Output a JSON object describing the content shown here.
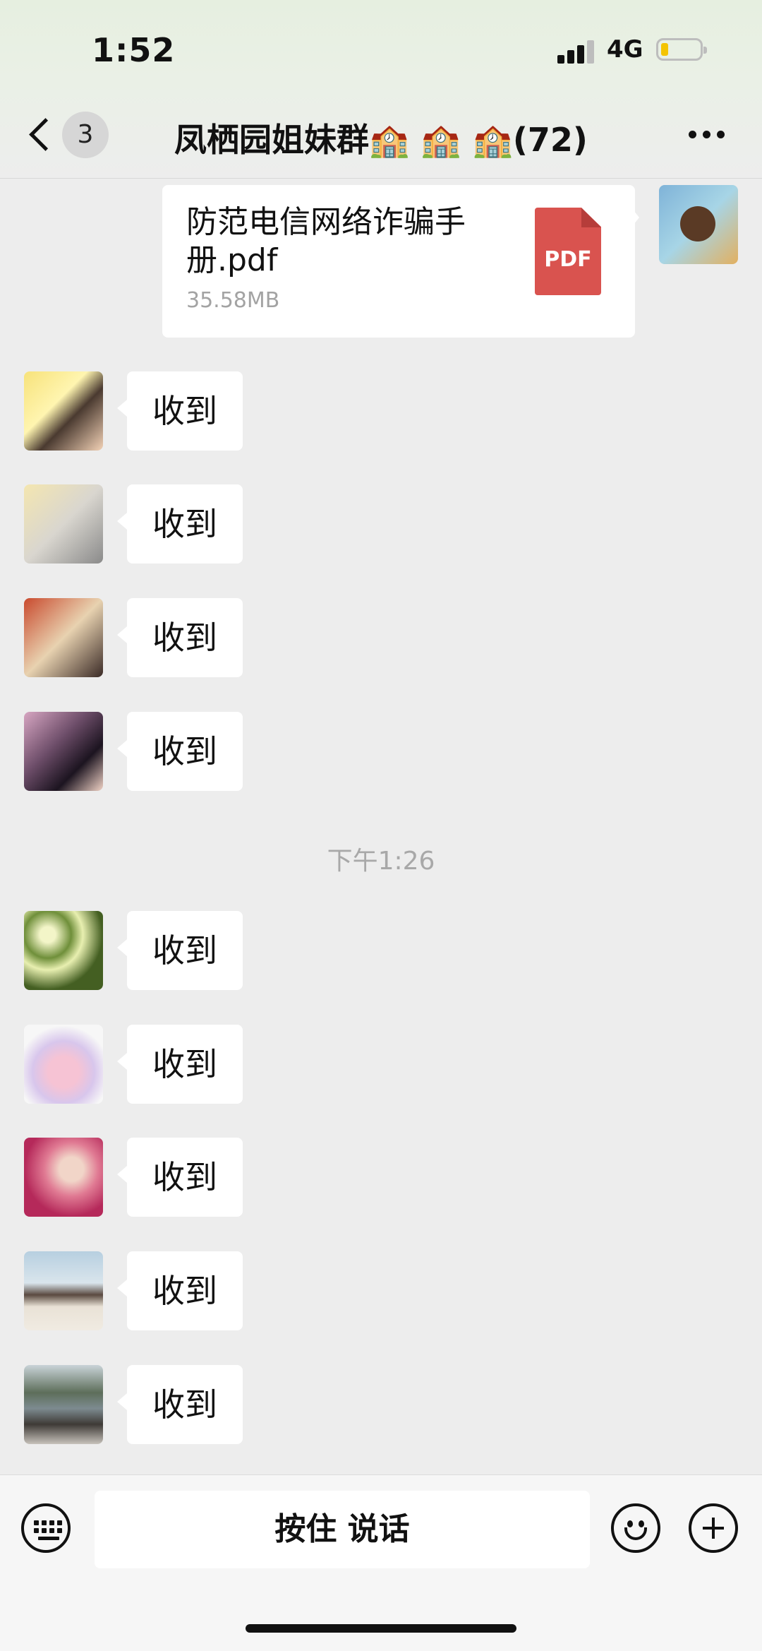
{
  "status_bar": {
    "time": "1:52",
    "network": "4G"
  },
  "header": {
    "back_icon": "chevron-left-icon",
    "unread_count": "3",
    "title": "凤栖园姐妹群🏫 🏫 🏫(72)",
    "more_icon": "ellipsis-icon"
  },
  "file_message": {
    "file_name": "防范电信网络诈骗手册.pdf",
    "file_size": "35.58MB",
    "file_type": "PDF"
  },
  "messages_before": [
    {
      "text": "收到",
      "avatar": "anime-girl-praying",
      "color": "#f7e27a"
    },
    {
      "text": "收到",
      "avatar": "anime-blonde-boy",
      "color": "#d9d6cf"
    },
    {
      "text": "收到",
      "avatar": "cartoon-family",
      "color": "#c94a2e"
    },
    {
      "text": "收到",
      "avatar": "anime-girl-dark-hair",
      "color": "#6e4e6a"
    }
  ],
  "time_separator": "下午1:26",
  "messages_after": [
    {
      "text": "收到",
      "avatar": "white-flowers",
      "color": "#6f8f3a"
    },
    {
      "text": "收到",
      "avatar": "pink-bunny-sticker",
      "color": "#d8c6ec"
    },
    {
      "text": "收到",
      "avatar": "pink-flowers-portrait",
      "color": "#e07a93"
    },
    {
      "text": "收到",
      "avatar": "beach-couple",
      "color": "#b7cfe0"
    },
    {
      "text": "收到",
      "avatar": "lakeside-couple",
      "color": "#5d6e5a"
    }
  ],
  "input_bar": {
    "voice_button_label": "按住 说话",
    "left_icon": "keyboard-icon",
    "emoji_icon": "emoji-icon",
    "plus_icon": "plus-icon"
  }
}
